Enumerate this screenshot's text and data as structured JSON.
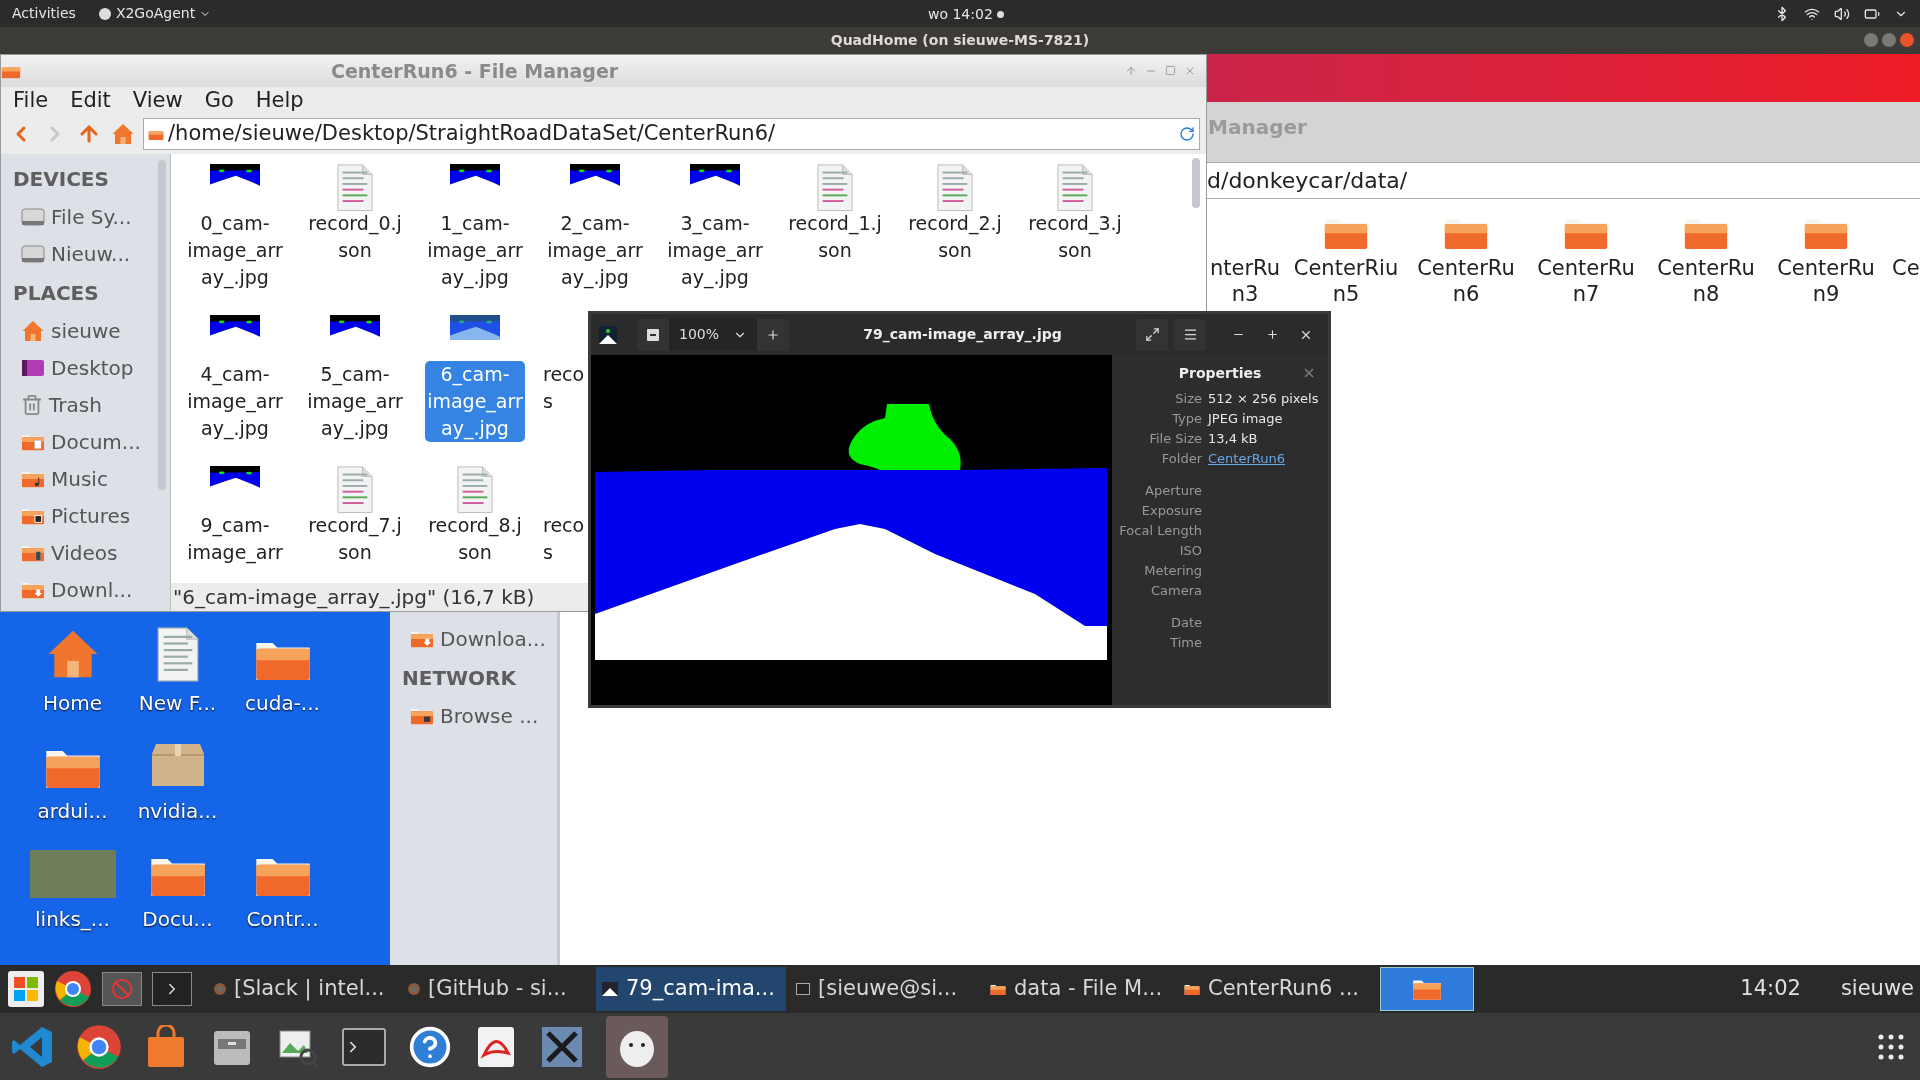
{
  "top_bar": {
    "activities": "Activities",
    "app_menu": "X2GoAgent",
    "clock": "wo 14:02"
  },
  "remote_title": "QuadHome (on sieuwe-MS-7821)",
  "back_window": {
    "title": "Manager",
    "path": "d/donkeycar/data/",
    "folders": [
      {
        "label_lines": [
          "nterRu",
          "n3"
        ]
      },
      {
        "label_lines": [
          "CenterRiu",
          "n5"
        ]
      },
      {
        "label_lines": [
          "CenterRu",
          "n6"
        ]
      },
      {
        "label_lines": [
          "CenterRu",
          "n7"
        ]
      },
      {
        "label_lines": [
          "CenterRu",
          "n8"
        ]
      },
      {
        "label_lines": [
          "CenterRu",
          "n9"
        ]
      },
      {
        "label_lines": [
          "Ce"
        ]
      }
    ],
    "sidebar": [
      {
        "items": [
          {
            "kind": "downloads",
            "label": "Downloa..."
          }
        ]
      },
      {
        "title": "NETWORK",
        "items": [
          {
            "kind": "network",
            "label": "Browse ..."
          }
        ]
      }
    ]
  },
  "desktop": [
    [
      {
        "kind": "home",
        "label": "Home"
      },
      {
        "kind": "document",
        "label": "New F..."
      },
      {
        "kind": "folder",
        "label": "cuda-..."
      }
    ],
    [
      {
        "kind": "folder",
        "label": "ardui..."
      },
      {
        "kind": "package",
        "label": "nvidia..."
      }
    ],
    [
      {
        "kind": "photo",
        "label": "links_..."
      },
      {
        "kind": "folder",
        "label": "Docu..."
      },
      {
        "kind": "folder",
        "label": "Contr..."
      }
    ]
  ],
  "front_window": {
    "title": "CenterRun6 - File Manager",
    "menu": [
      "File",
      "Edit",
      "View",
      "Go",
      "Help"
    ],
    "nav": [
      {
        "kind": "back",
        "disabled": false
      },
      {
        "kind": "forward",
        "disabled": true
      },
      {
        "kind": "up",
        "disabled": false
      },
      {
        "kind": "home",
        "disabled": false
      }
    ],
    "path": "/home/sieuwe/Desktop/StraightRoadDataSet/CenterRun6/",
    "sidebar": [
      {
        "title": "DEVICES",
        "items": [
          {
            "kind": "drive",
            "label": "File Sy..."
          },
          {
            "kind": "drive",
            "label": "Nieuw..."
          }
        ]
      },
      {
        "title": "PLACES",
        "items": [
          {
            "kind": "home",
            "label": "sieuwe"
          },
          {
            "kind": "desktop",
            "label": "Desktop"
          },
          {
            "kind": "trash",
            "label": "Trash"
          },
          {
            "kind": "documents",
            "label": "Docum..."
          },
          {
            "kind": "music",
            "label": "Music"
          },
          {
            "kind": "pictures",
            "label": "Pictures"
          },
          {
            "kind": "videos",
            "label": "Videos"
          },
          {
            "kind": "downloads",
            "label": "Downl..."
          }
        ]
      }
    ],
    "files": [
      [
        {
          "kind": "image",
          "label_lines": [
            "0_cam-",
            "image_arr",
            "ay_.jpg"
          ],
          "selected": false
        },
        {
          "kind": "json",
          "label_lines": [
            "record_0.j",
            "son"
          ],
          "selected": false
        },
        {
          "kind": "image",
          "label_lines": [
            "1_cam-",
            "image_arr",
            "ay_.jpg"
          ],
          "selected": false
        },
        {
          "kind": "image",
          "label_lines": [
            "2_cam-",
            "image_arr",
            "ay_.jpg"
          ],
          "selected": false
        },
        {
          "kind": "image",
          "label_lines": [
            "3_cam-",
            "image_arr",
            "ay_.jpg"
          ],
          "selected": false
        },
        {
          "kind": "json",
          "label_lines": [
            "record_1.j",
            "son"
          ],
          "selected": false
        },
        {
          "kind": "json",
          "label_lines": [
            "record_2.j",
            "son"
          ],
          "selected": false
        },
        {
          "kind": "json",
          "label_lines": [
            "record_3.j",
            "son"
          ],
          "selected": false
        }
      ],
      [
        {
          "kind": "image",
          "label_lines": [
            "4_cam-",
            "image_arr",
            "ay_.jpg"
          ],
          "selected": false
        },
        {
          "kind": "image",
          "label_lines": [
            "5_cam-",
            "image_arr",
            "ay_.jpg"
          ],
          "selected": false
        },
        {
          "kind": "image",
          "label_lines": [
            "6_cam-",
            "image_arr",
            "ay_.jpg"
          ],
          "selected": true
        },
        {
          "kind": "partial",
          "label_lines": [
            "reco",
            "s"
          ],
          "selected": false
        }
      ],
      [
        {
          "kind": "image",
          "label_lines": [
            "9_cam-",
            "image_arr"
          ],
          "selected": false
        },
        {
          "kind": "json",
          "label_lines": [
            "record_7.j",
            "son"
          ],
          "selected": false
        },
        {
          "kind": "json",
          "label_lines": [
            "record_8.j",
            "son"
          ],
          "selected": false
        },
        {
          "kind": "partial",
          "label_lines": [
            "reco",
            "s"
          ],
          "selected": false
        }
      ]
    ],
    "status": "\"6_cam-image_array_.jpg\" (16,7 kB)"
  },
  "viewer": {
    "title": "79_cam-image_array_.jpg",
    "zoom": "100%",
    "properties": {
      "title": "Properties",
      "rows": [
        {
          "label": "Size",
          "value": "512 × 256 pixels",
          "kind": "text"
        },
        {
          "label": "Type",
          "value": "JPEG image",
          "kind": "text"
        },
        {
          "label": "File Size",
          "value": "13,4 kB",
          "kind": "text"
        },
        {
          "label": "Folder",
          "value": "CenterRun6",
          "kind": "link"
        }
      ],
      "exif": [
        "Aperture",
        "Exposure",
        "Focal Length",
        "ISO",
        "Metering",
        "Camera"
      ],
      "datetime": [
        "Date",
        "Time"
      ]
    }
  },
  "taskbar": {
    "tasks": [
      {
        "kind": "chrome",
        "label": "[Slack | intel...",
        "selected": false
      },
      {
        "kind": "chrome",
        "label": "[GitHub - si...",
        "selected": false
      },
      {
        "kind": "viewer",
        "label": "79_cam-ima...",
        "selected": true
      },
      {
        "kind": "terminal",
        "label": "[sieuwe@si...",
        "selected": false
      },
      {
        "kind": "folder",
        "label": "data - File M...",
        "selected": false
      },
      {
        "kind": "folder",
        "label": "CenterRun6 ...",
        "selected": false
      }
    ],
    "clock": "14:02",
    "user": "sieuwe"
  }
}
